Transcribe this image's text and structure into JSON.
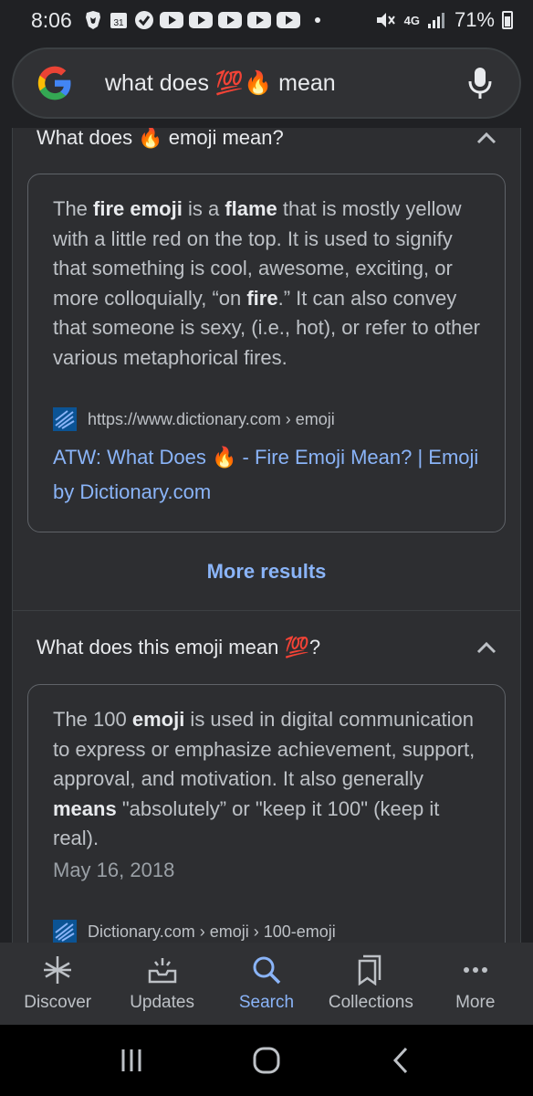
{
  "status_bar": {
    "time": "8:06",
    "calendar_day": "31",
    "network": "4G",
    "battery": "71%"
  },
  "search": {
    "query": "what does 💯🔥 mean"
  },
  "section1": {
    "question": "What does 🔥 emoji mean?",
    "answer": {
      "t1": "The ",
      "b1": "fire emoji",
      "t2": " is a ",
      "b2": "flame",
      "t3": " that is mostly yellow with a little red on the top. It is used to signify that something is cool, awesome, exciting, or more colloquially, “on ",
      "b3": "fire",
      "t4": ".” It can also convey that someone is sexy, (i.e., hot), or refer to other various metaphorical fires."
    },
    "source": "https://www.dictionary.com › emoji",
    "link": "ATW: What Does 🔥 - Fire Emoji Mean? | Emoji by Dictionary.com",
    "more": "More results"
  },
  "section2": {
    "question": "What does this emoji mean 💯?",
    "answer": {
      "t1": "The 100 ",
      "b1": "emoji",
      "t2": " is used in digital communication to express or emphasize achievement, support, approval, and motivation. It also generally ",
      "b2": "means",
      "t3": " \"absolutely” or \"keep it 100\" (keep it real).",
      "date": "May 16, 2018"
    },
    "source": "Dictionary.com › emoji › 100-emoji"
  },
  "bottom_nav": {
    "discover": "Discover",
    "updates": "Updates",
    "search": "Search",
    "collections": "Collections",
    "more": "More"
  },
  "colors": {
    "background": "#202124",
    "panel": "#2d2e31",
    "link": "#8ab4f8",
    "text": "#bdc1c6"
  },
  "icons": [
    "google-logo",
    "mic-icon",
    "chevron-up-icon",
    "dictionary-favicon",
    "asterisk-icon",
    "updates-icon",
    "search-icon",
    "collections-icon",
    "more-dots-icon",
    "recents-icon",
    "home-icon",
    "back-icon"
  ]
}
